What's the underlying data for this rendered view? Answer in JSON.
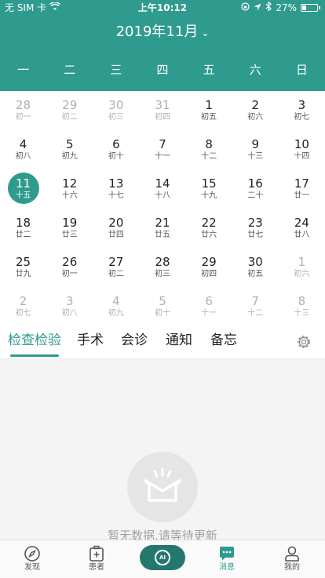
{
  "status_bar": {
    "carrier": "无 SIM 卡",
    "time": "上午10:12",
    "battery_pct": "27%",
    "battery_level": 0.27
  },
  "header": {
    "month_title": "2019年11月",
    "weekdays": [
      "一",
      "二",
      "三",
      "四",
      "五",
      "六",
      "日"
    ]
  },
  "calendar": {
    "weeks": [
      [
        {
          "day": "28",
          "lunar": "初一",
          "other": true
        },
        {
          "day": "29",
          "lunar": "初二",
          "other": true
        },
        {
          "day": "30",
          "lunar": "初三",
          "other": true
        },
        {
          "day": "31",
          "lunar": "初四",
          "other": true
        },
        {
          "day": "1",
          "lunar": "初五"
        },
        {
          "day": "2",
          "lunar": "初六"
        },
        {
          "day": "3",
          "lunar": "初七"
        }
      ],
      [
        {
          "day": "4",
          "lunar": "初八"
        },
        {
          "day": "5",
          "lunar": "初九"
        },
        {
          "day": "6",
          "lunar": "初十"
        },
        {
          "day": "7",
          "lunar": "十一"
        },
        {
          "day": "8",
          "lunar": "十二"
        },
        {
          "day": "9",
          "lunar": "十三"
        },
        {
          "day": "10",
          "lunar": "十四"
        }
      ],
      [
        {
          "day": "11",
          "lunar": "十五",
          "selected": true
        },
        {
          "day": "12",
          "lunar": "十六"
        },
        {
          "day": "13",
          "lunar": "十七"
        },
        {
          "day": "14",
          "lunar": "十八"
        },
        {
          "day": "15",
          "lunar": "十九"
        },
        {
          "day": "16",
          "lunar": "二十"
        },
        {
          "day": "17",
          "lunar": "廿一"
        }
      ],
      [
        {
          "day": "18",
          "lunar": "廿二"
        },
        {
          "day": "19",
          "lunar": "廿三"
        },
        {
          "day": "20",
          "lunar": "廿四"
        },
        {
          "day": "21",
          "lunar": "廿五"
        },
        {
          "day": "22",
          "lunar": "廿六"
        },
        {
          "day": "23",
          "lunar": "廿七"
        },
        {
          "day": "24",
          "lunar": "廿八"
        }
      ],
      [
        {
          "day": "25",
          "lunar": "廿九"
        },
        {
          "day": "26",
          "lunar": "初一"
        },
        {
          "day": "27",
          "lunar": "初二"
        },
        {
          "day": "28",
          "lunar": "初三"
        },
        {
          "day": "29",
          "lunar": "初四"
        },
        {
          "day": "30",
          "lunar": "初五"
        },
        {
          "day": "1",
          "lunar": "初六",
          "other": true
        }
      ],
      [
        {
          "day": "2",
          "lunar": "初七",
          "other": true
        },
        {
          "day": "3",
          "lunar": "初八",
          "other": true
        },
        {
          "day": "4",
          "lunar": "初九",
          "other": true
        },
        {
          "day": "5",
          "lunar": "初十",
          "other": true
        },
        {
          "day": "6",
          "lunar": "十一",
          "other": true
        },
        {
          "day": "7",
          "lunar": "十二",
          "other": true
        },
        {
          "day": "8",
          "lunar": "十三",
          "other": true
        }
      ]
    ]
  },
  "tabs": {
    "items": [
      "检查检验",
      "手术",
      "会诊",
      "通知",
      "备忘"
    ],
    "active": 0
  },
  "empty_state": {
    "message": "暂无数据,请等待更新"
  },
  "tabbar": {
    "items": [
      {
        "label": "发现",
        "icon": "compass-icon"
      },
      {
        "label": "患者",
        "icon": "medical-kit-icon"
      },
      {
        "label": "AI",
        "icon": "ai-icon"
      },
      {
        "label": "消息",
        "icon": "message-icon",
        "active": true
      },
      {
        "label": "我的",
        "icon": "person-icon"
      }
    ]
  },
  "colors": {
    "accent": "#2e9b8e",
    "ai_button": "#24776d",
    "empty_bg": "#f4f4f4"
  }
}
